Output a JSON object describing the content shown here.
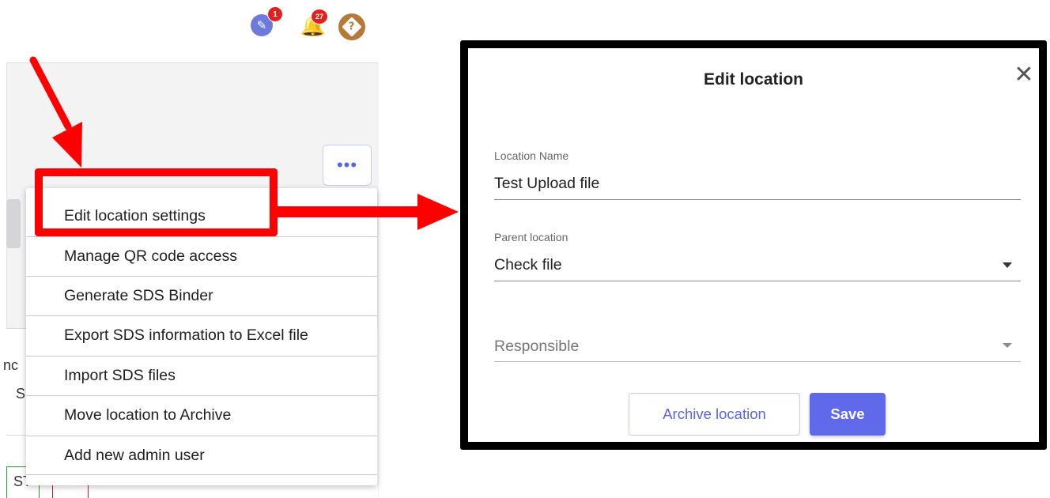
{
  "header": {
    "notes_badge": "1",
    "notifications_badge": "27",
    "help_glyph": "?"
  },
  "background": {
    "more_button_label": "•••",
    "fragment_1": "nc",
    "fragment_2": "S",
    "fragment_3": "ST"
  },
  "menu": {
    "items": [
      {
        "label": "Edit location settings"
      },
      {
        "label": "Manage QR code access"
      },
      {
        "label": "Generate SDS Binder"
      },
      {
        "label": "Export SDS information to Excel file"
      },
      {
        "label": "Import SDS files"
      },
      {
        "label": "Move location to Archive"
      },
      {
        "label": "Add new admin user"
      }
    ]
  },
  "modal": {
    "title": "Edit location",
    "close_glyph": "✕",
    "location_name_label": "Location Name",
    "location_name_value": "Test Upload file",
    "parent_label": "Parent location",
    "parent_value": "Check file",
    "responsible_placeholder": "Responsible",
    "archive_button": "Archive location",
    "save_button": "Save"
  },
  "colors": {
    "accent": "#5f69ea",
    "annotation_red": "#ff0000",
    "badge_red": "#e12020",
    "help_brown": "#b57a3a"
  },
  "icons": [
    "notes-icon",
    "bell-icon",
    "help-icon",
    "close-icon",
    "chevron-down-icon"
  ]
}
